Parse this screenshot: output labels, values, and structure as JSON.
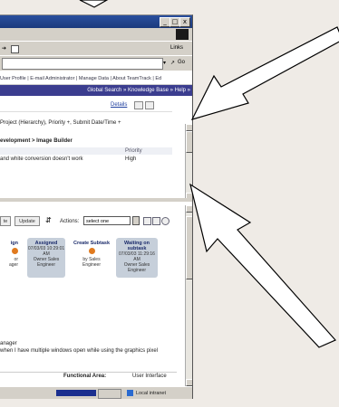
{
  "window": {
    "title_controls": [
      "_",
      "□",
      "x"
    ],
    "menu_right": "",
    "toolbar_links": "Links",
    "address_go": "Go"
  },
  "nav": {
    "links": "User Profile | E-mail Administrator | Manage Data | About TeamTrack | Ed",
    "purple_links": "Global Search » Knowledge Base » Help »"
  },
  "panel1": {
    "details_link": "Details",
    "sort_line": "Project (Hierarchy), Priority +, Submit Date/Time +",
    "breadcrumb": "evelopment > Image Builder",
    "priority_header": "Priority",
    "row_title": "and white conversion doesn't work",
    "row_priority": "High"
  },
  "panel2": {
    "btn_left": "te",
    "btn_update": "Update",
    "actions_label": "Actions:",
    "actions_select": "select one",
    "workflow": [
      {
        "title": "ign",
        "lines": [
          "",
          "or",
          "ager"
        ]
      },
      {
        "title": "Assigned",
        "lines": [
          "07/03/03 10:29:01",
          "AM",
          "Owner Sales",
          "Engineer"
        ]
      },
      {
        "title": "Create Subtask",
        "lines": [
          "by Sales",
          "Engineer"
        ]
      },
      {
        "title": "Waiting on subtask",
        "lines": [
          "07/03/03 11:29:16",
          "AM",
          "Owner Sales",
          "Engineer"
        ]
      }
    ],
    "desc_line1": "anager",
    "desc_line2": "when I have multiple windows open while using the graphics pixel",
    "functional_area_label": "Functional Area:",
    "functional_area_value": "User Interface"
  },
  "status": {
    "zone": "Local intranet"
  },
  "colors": {
    "slide_bg": "#efebe6",
    "title_blue": "#1b3a7d",
    "nav_purple": "#3b3d8f",
    "workflow_box": "#c6cfda",
    "workflow_dot": "#e07a1f"
  }
}
